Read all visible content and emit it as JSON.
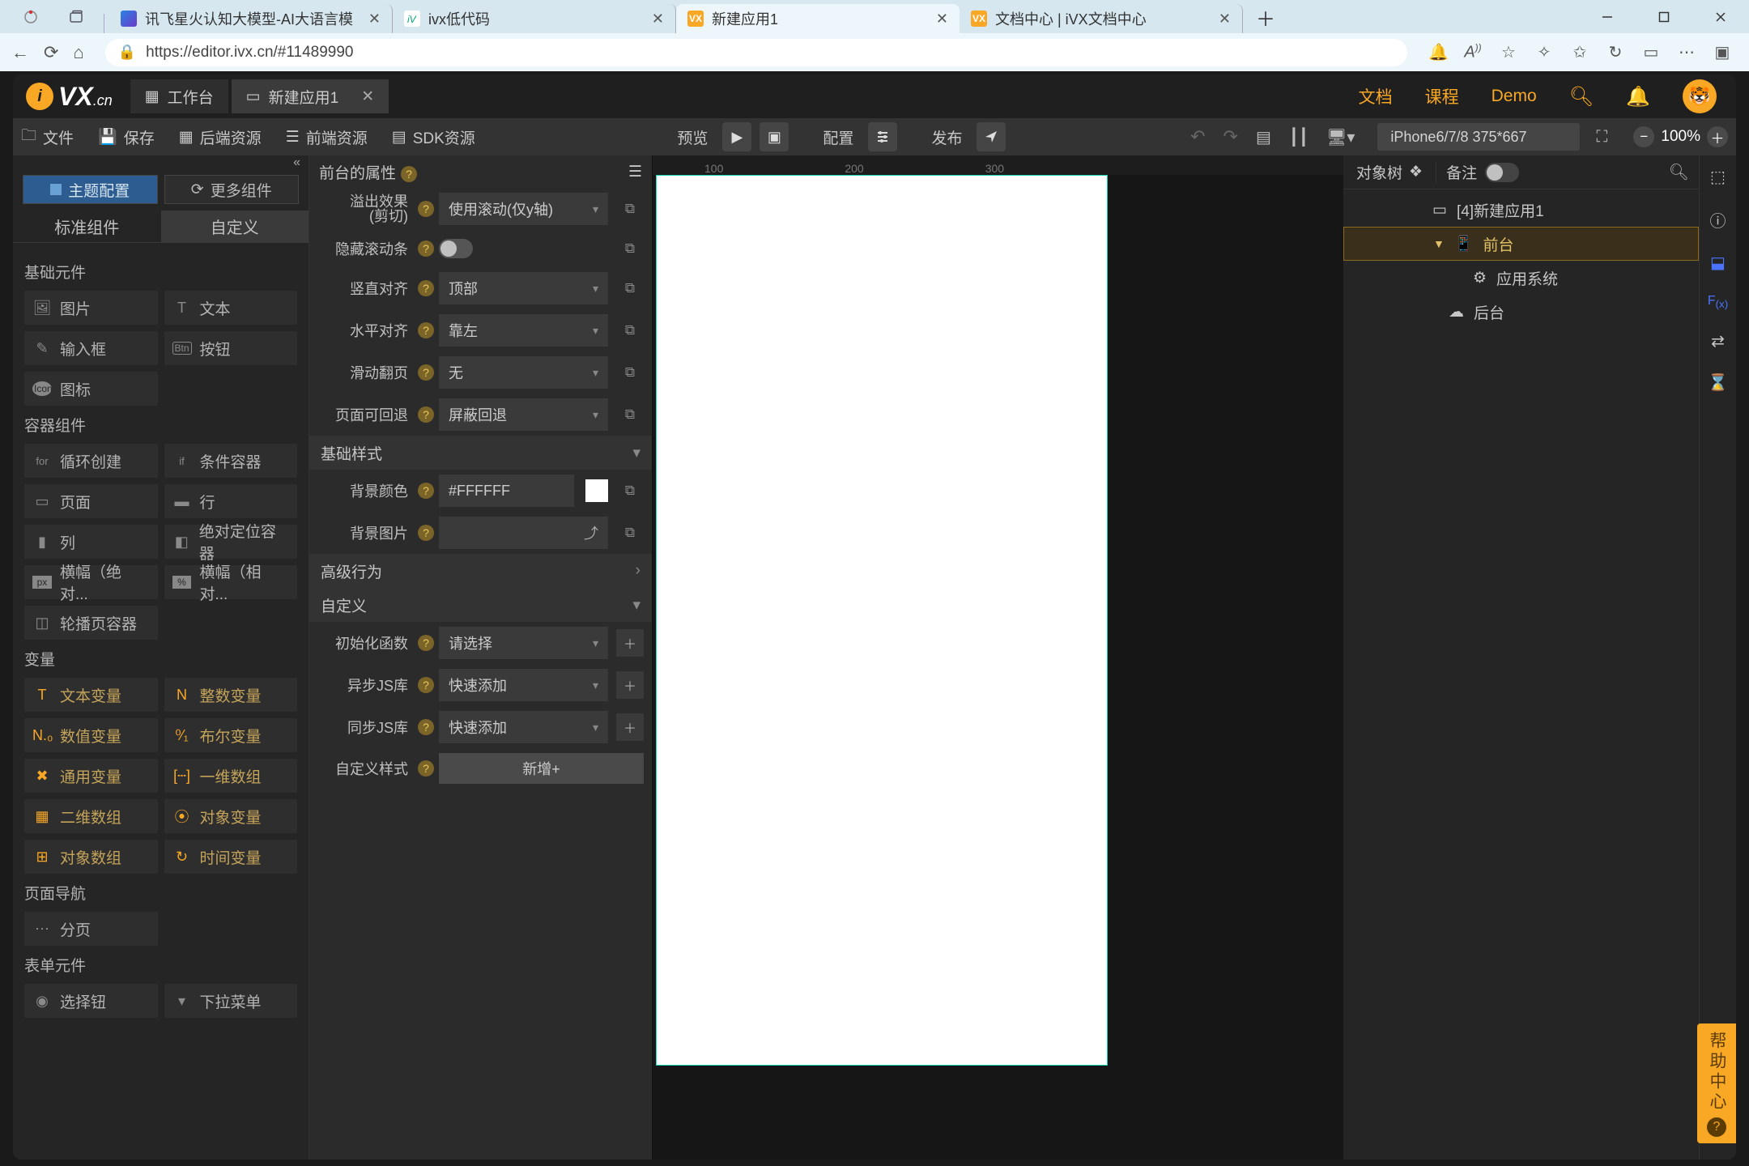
{
  "browser": {
    "tabs": [
      {
        "label": "讯飞星火认知大模型-AI大语言模"
      },
      {
        "label": "ivx低代码"
      },
      {
        "label": "新建应用1"
      },
      {
        "label": "文档中心 | iVX文档中心"
      }
    ],
    "url": "https://editor.ivx.cn/#11489990"
  },
  "topbar": {
    "workspace": "工作台",
    "app_tab": "新建应用1",
    "links": {
      "docs": "文档",
      "course": "课程",
      "demo": "Demo"
    }
  },
  "toolbar": {
    "file": "文件",
    "save": "保存",
    "backend": "后端资源",
    "frontend": "前端资源",
    "sdk": "SDK资源",
    "preview": "预览",
    "config": "配置",
    "publish": "发布",
    "device": "iPhone6/7/8 375*667",
    "zoom": "100%"
  },
  "left": {
    "theme": "主题配置",
    "more": "更多组件",
    "tab_std": "标准组件",
    "tab_custom": "自定义",
    "sections": {
      "basic": {
        "title": "基础元件",
        "items": [
          "图片",
          "文本",
          "输入框",
          "按钮",
          "图标"
        ]
      },
      "container": {
        "title": "容器组件",
        "items": [
          "循环创建",
          "条件容器",
          "页面",
          "行",
          "列",
          "绝对定位容器",
          "横幅（绝对...",
          "横幅（相对...",
          "轮播页容器"
        ]
      },
      "vars": {
        "title": "变量",
        "items": [
          "文本变量",
          "整数变量",
          "数值变量",
          "布尔变量",
          "通用变量",
          "一维数组",
          "二维数组",
          "对象变量",
          "对象数组",
          "时间变量"
        ]
      },
      "nav": {
        "title": "页面导航",
        "items": [
          "分页"
        ]
      },
      "form": {
        "title": "表单元件",
        "items": [
          "选择钮",
          "下拉菜单"
        ]
      }
    }
  },
  "props": {
    "title": "前台的属性",
    "overflow_label": "溢出效果\n(剪切)",
    "overflow_value": "使用滚动(仅y轴)",
    "hide_scroll": "隐藏滚动条",
    "valign_label": "竖直对齐",
    "valign_value": "顶部",
    "halign_label": "水平对齐",
    "halign_value": "靠左",
    "swipe_label": "滑动翻页",
    "swipe_value": "无",
    "back_label": "页面可回退",
    "back_value": "屏蔽回退",
    "basic_style": "基础样式",
    "bg_color_label": "背景颜色",
    "bg_color_value": "#FFFFFF",
    "bg_image_label": "背景图片",
    "advanced": "高级行为",
    "custom": "自定义",
    "init_fn_label": "初始化函数",
    "init_fn_value": "请选择",
    "async_label": "异步JS库",
    "async_value": "快速添加",
    "sync_label": "同步JS库",
    "sync_value": "快速添加",
    "custom_style_label": "自定义样式",
    "custom_style_btn": "新增+"
  },
  "ruler": {
    "marks": [
      "100",
      "200",
      "300"
    ]
  },
  "right": {
    "tree_tab": "对象树",
    "memo": "备注",
    "nodes": {
      "app": "[4]新建应用1",
      "front": "前台",
      "system": "应用系统",
      "back": "后台"
    }
  },
  "help": {
    "text": "帮助中心"
  }
}
